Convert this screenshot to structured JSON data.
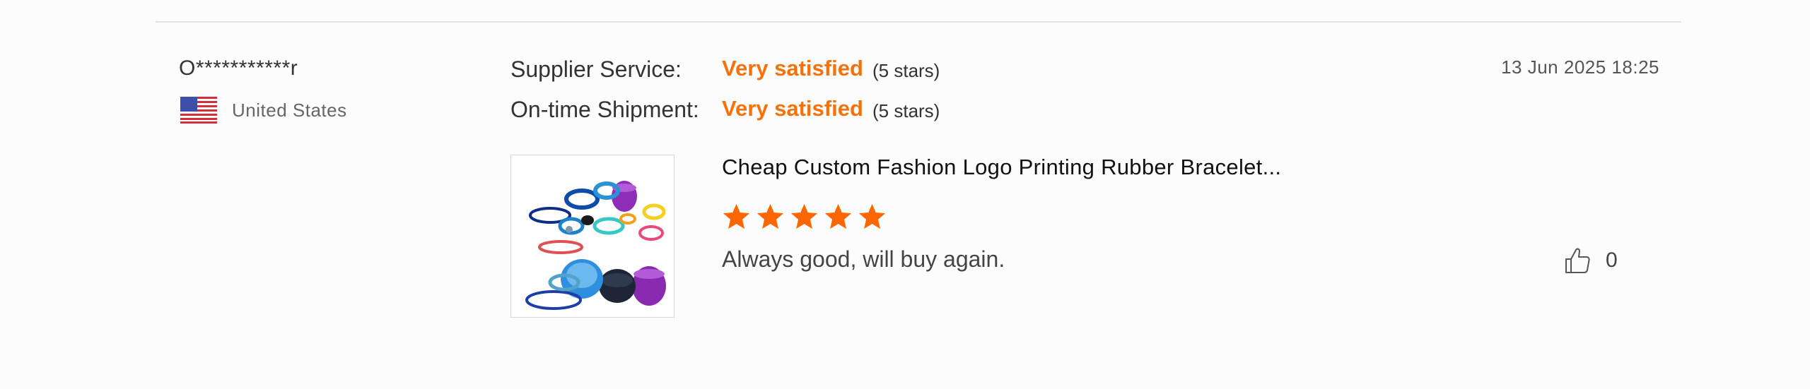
{
  "review": {
    "reviewer_name": "O***********r",
    "country": "United States",
    "flag_icon": "us-flag-icon",
    "date": "13 Jun 2025 18:25",
    "ratings": [
      {
        "label": "Supplier Service:",
        "value": "Very satisfied",
        "stars_text": "(5 stars)"
      },
      {
        "label": "On-time Shipment:",
        "value": "Very satisfied",
        "stars_text": "(5 stars)"
      }
    ],
    "product_title": "Cheap Custom Fashion Logo Printing Rubber Bracelet...",
    "product_rating": 5,
    "product_rating_max": 5,
    "review_text": "Always good, will buy again.",
    "like_count": "0",
    "like_icon": "thumbs-up-icon"
  },
  "colors": {
    "accent_orange": "#f5720a",
    "star_orange": "#ff6600",
    "divider": "#e3e3e3",
    "text_dark": "#333333"
  }
}
